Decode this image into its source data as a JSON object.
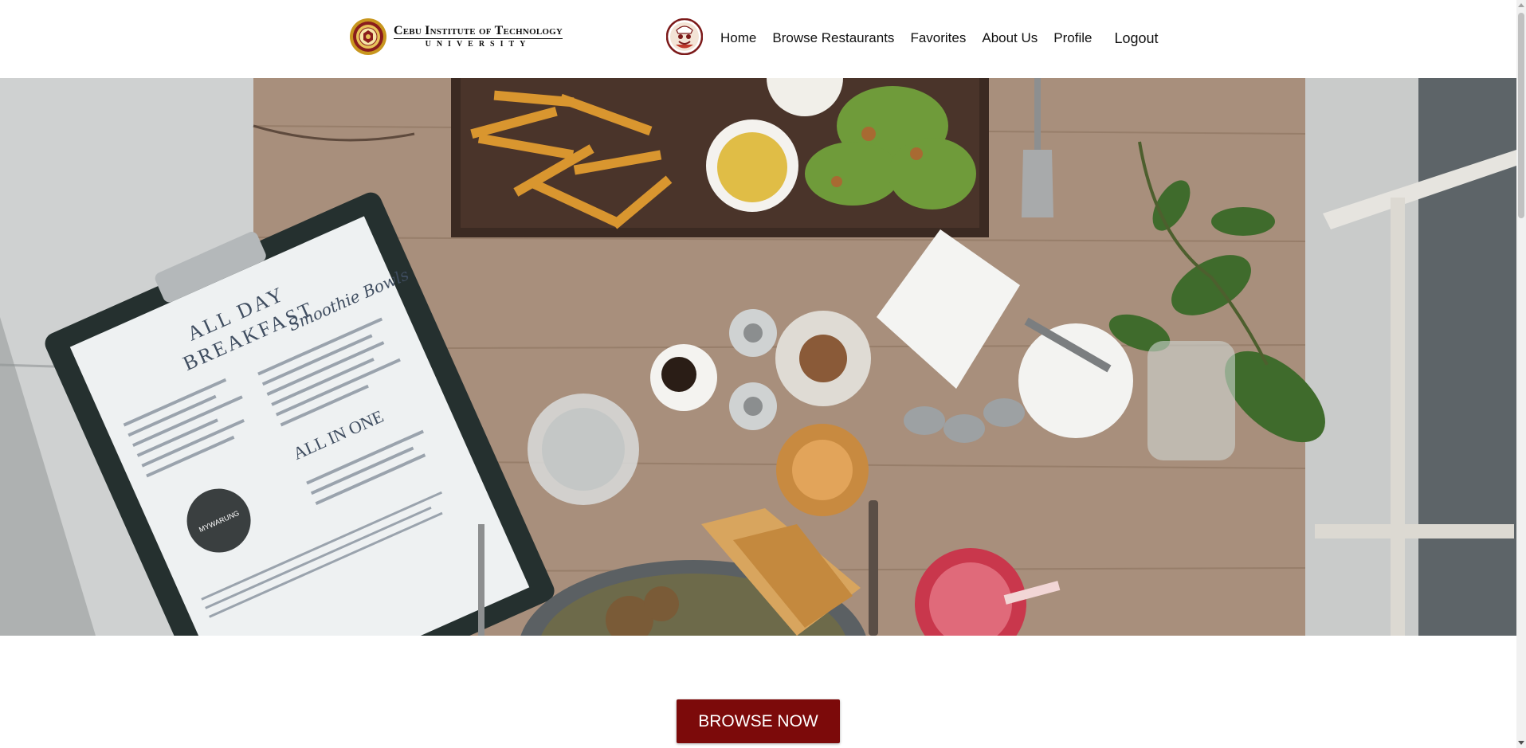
{
  "header": {
    "logo_line1": "Cebu Institute of Technology",
    "logo_line2": "UNIVERSITY"
  },
  "nav": {
    "items": [
      "Home",
      "Browse Restaurants",
      "Favorites",
      "About Us",
      "Profile"
    ],
    "logout": "Logout"
  },
  "hero": {
    "menu_title_1": "ALL DAY",
    "menu_title_2": "BREAKFAST",
    "menu_script": "Smoothie Bowls",
    "menu_section": "ALL IN ONE",
    "menu_badge": "MYWARUNG"
  },
  "cta": {
    "label": "BROWSE NOW"
  },
  "colors": {
    "accent": "#7c0a0a",
    "header_bg": "#ffffff",
    "text": "#111111"
  }
}
